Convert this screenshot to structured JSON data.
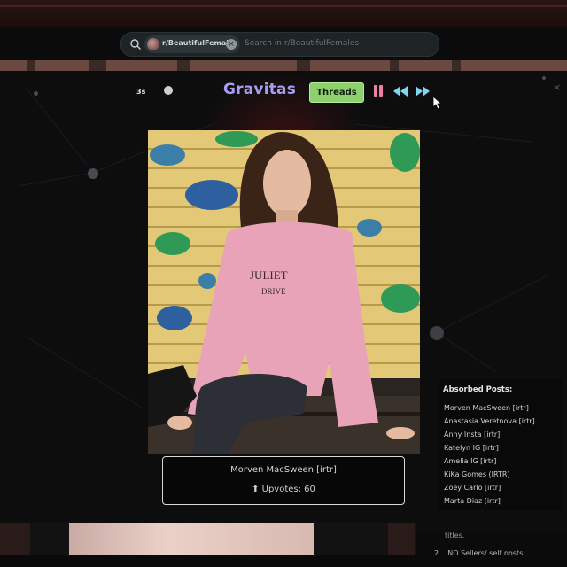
{
  "search": {
    "community_chip": "r/BeautifulFemales",
    "placeholder": "Search in r/BeautifulFemales"
  },
  "viewer": {
    "timer": "3s",
    "brand": "Gravitas",
    "threads_label": "Threads",
    "close_glyph": "×",
    "accent_color": "#a79ef5",
    "controls": [
      "pause-icon",
      "rewind-icon",
      "fast-forward-icon"
    ]
  },
  "post": {
    "title": "Morven MacSween [irtr]",
    "upvotes": "⬆ Upvotes: 60"
  },
  "absorbed": {
    "heading": "Absorbed Posts:",
    "items": [
      "Morven MacSween [irtr]",
      "Anastasia Veretnova [irtr]",
      "Anny Insta [irtr]",
      "Katelyn IG [irtr]",
      "Amelia IG [irtr]",
      "KiKa Gomes (IRTR)",
      "Zoey Carlo [irtr]",
      "Marta Diaz [irtr]"
    ]
  },
  "background_page": {
    "rule_text": "titles.",
    "rule_num": "2",
    "rule_label": "NO Sellers/ self posts"
  }
}
